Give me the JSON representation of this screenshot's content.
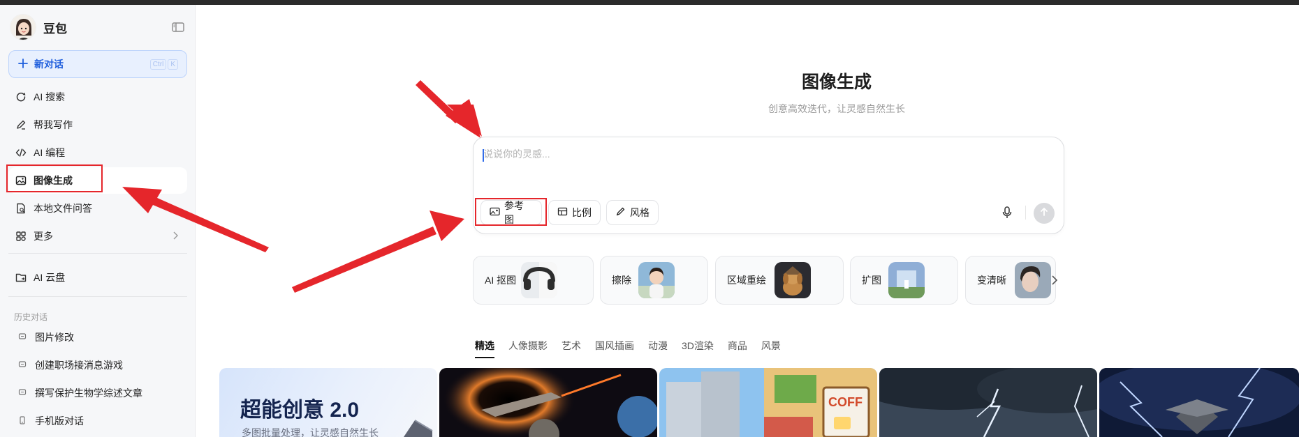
{
  "sidebar": {
    "brand": "豆包",
    "new_chat": {
      "label": "新对话",
      "shortcut": [
        "Ctrl",
        "K"
      ]
    },
    "nav": [
      {
        "label": "AI 搜索",
        "icon": "ai-search-icon"
      },
      {
        "label": "帮我写作",
        "icon": "pen-icon"
      },
      {
        "label": "AI 编程",
        "icon": "code-icon"
      },
      {
        "label": "图像生成",
        "icon": "image-icon",
        "active": true
      },
      {
        "label": "本地文件问答",
        "icon": "file-icon"
      },
      {
        "label": "更多",
        "icon": "grid-icon"
      }
    ],
    "cloud": {
      "label": "AI 云盘",
      "icon": "cloud-folder-icon"
    },
    "history_label": "历史对话",
    "history": [
      {
        "label": "图片修改"
      },
      {
        "label": "创建职场接消息游戏"
      },
      {
        "label": "撰写保护生物学综述文章"
      },
      {
        "label": "手机版对话",
        "icon": "phone-icon"
      }
    ]
  },
  "main": {
    "title": "图像生成",
    "subtitle": "创意高效迭代，让灵感自然生长",
    "composer": {
      "placeholder": "说说你的灵感...",
      "chips": [
        {
          "label": "参考图",
          "icon": "reference-image-icon"
        },
        {
          "label": "比例",
          "icon": "ratio-icon"
        },
        {
          "label": "风格",
          "icon": "brush-icon"
        }
      ]
    },
    "tools": [
      {
        "label": "AI 抠图"
      },
      {
        "label": "擦除"
      },
      {
        "label": "区域重绘"
      },
      {
        "label": "扩图"
      },
      {
        "label": "变清晰"
      }
    ],
    "tabs": [
      "精选",
      "人像摄影",
      "艺术",
      "国风插画",
      "动漫",
      "3D渲染",
      "商品",
      "风景"
    ],
    "active_tab": "精选",
    "promo": {
      "title": "超能创意 2.0",
      "subtitle": "多图批量处理，让灵感自然生长"
    }
  },
  "colors": {
    "accent": "#1d5ddc",
    "highlight": "#e5262b",
    "sidebar_bg": "#f6f7f9"
  }
}
